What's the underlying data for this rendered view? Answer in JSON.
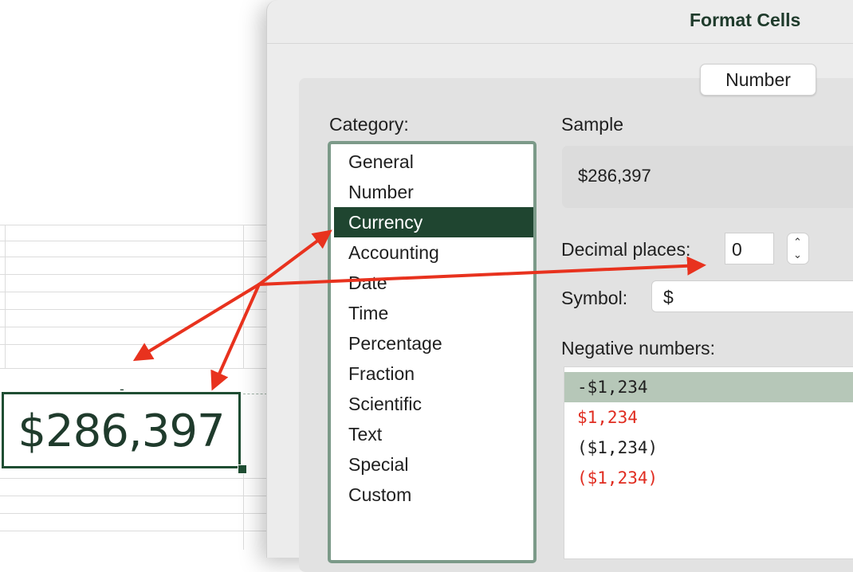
{
  "dialog": {
    "title": "Format Cells",
    "tab_label": "Number"
  },
  "category": {
    "label": "Category:",
    "items": [
      "General",
      "Number",
      "Currency",
      "Accounting",
      "Date",
      "Time",
      "Percentage",
      "Fraction",
      "Scientific",
      "Text",
      "Special",
      "Custom"
    ],
    "selected": "Currency"
  },
  "sample": {
    "label": "Sample",
    "value": "$286,397"
  },
  "decimal": {
    "label": "Decimal places:",
    "value": "0"
  },
  "symbol": {
    "label": "Symbol:",
    "value": "$"
  },
  "negative": {
    "label": "Negative numbers:",
    "items": [
      "-$1,234",
      "$1,234",
      "($1,234)",
      "($1,234)"
    ],
    "selected_index": 0,
    "red_indices": [
      1,
      3
    ]
  },
  "sheet": {
    "cell_value": "$286,397",
    "dash_text": "-"
  },
  "colors": {
    "accent_green": "#1f4530",
    "annotation_red": "#e8321e",
    "negative_red": "#e02c20"
  }
}
